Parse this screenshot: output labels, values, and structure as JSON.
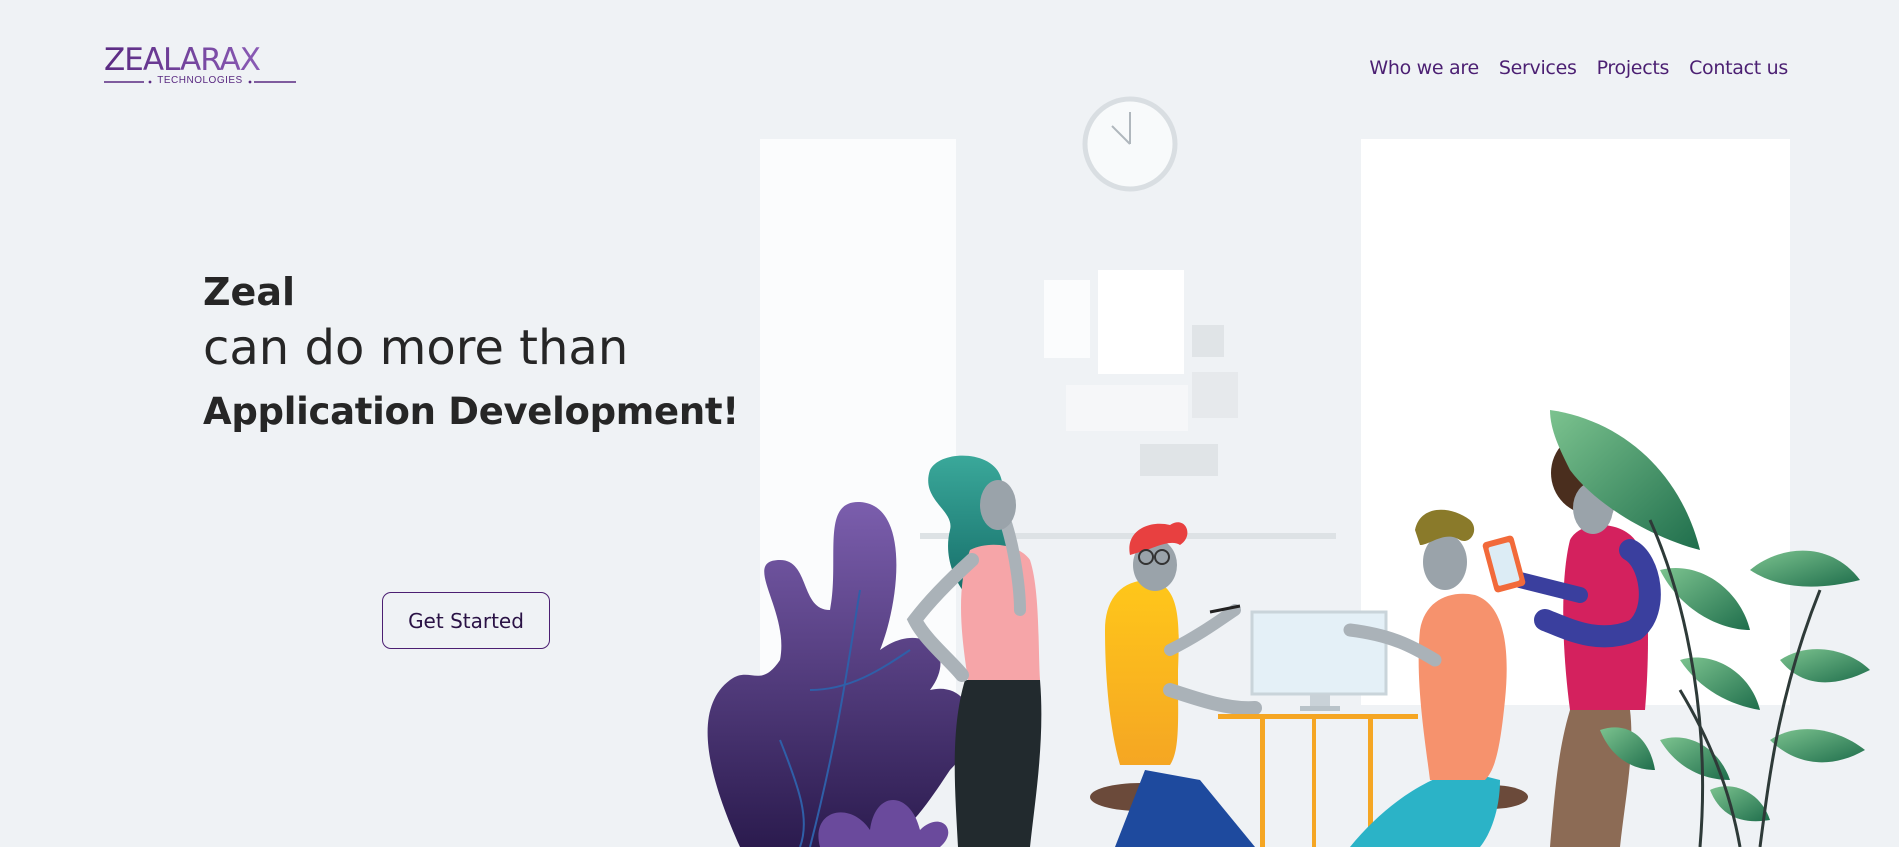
{
  "brand": {
    "name": "ZEALARAX",
    "tagline": "TECHNOLOGIES",
    "color": "#5a2a82"
  },
  "nav": {
    "items": [
      {
        "label": "Who we are"
      },
      {
        "label": "Services"
      },
      {
        "label": "Projects"
      },
      {
        "label": "Contact us"
      }
    ],
    "color": "#4b1f72"
  },
  "hero": {
    "line1": "Zeal",
    "line2": "can do more than",
    "line3": "Application Development!",
    "cta_label": "Get Started"
  },
  "illustration": {
    "icons": [
      "wall-clock-icon",
      "window-icon",
      "purple-plant-icon",
      "green-plant-icon",
      "computer-monitor-icon",
      "tablet-icon"
    ]
  }
}
